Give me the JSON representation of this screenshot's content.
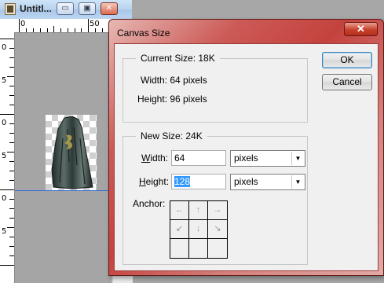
{
  "document_window": {
    "title": "Untitl...",
    "buttons": {
      "minimize": "▭",
      "maximize": "▣",
      "close": "✕"
    },
    "ruler": {
      "h_labels": [
        "0",
        "50"
      ],
      "v_labels": [
        "0",
        "5",
        "0",
        "5",
        "0",
        "5"
      ]
    }
  },
  "dialog": {
    "title": "Canvas Size",
    "close_label": "✕",
    "current_size": {
      "legend": "Current Size:  18K",
      "width_text": "Width:  64 pixels",
      "height_text": "Height:  96 pixels"
    },
    "new_size": {
      "legend": "New Size:  24K",
      "width_label_u": "W",
      "width_label_rest": "idth:",
      "width_value": "64",
      "width_unit": "pixels",
      "height_label_u": "H",
      "height_label_rest": "eight:",
      "height_value": "128",
      "height_unit": "pixels"
    },
    "anchor": {
      "label": "Anchor:",
      "arrows": [
        "←",
        "↑",
        "→",
        "↙",
        "↓",
        "↘",
        "",
        "",
        ""
      ]
    },
    "ok_label": "OK",
    "cancel_label": "Cancel"
  },
  "colors": {
    "dialog_frame": "#c4423e",
    "guide_line": "#3b6cd6",
    "selection": "#3399ff"
  }
}
